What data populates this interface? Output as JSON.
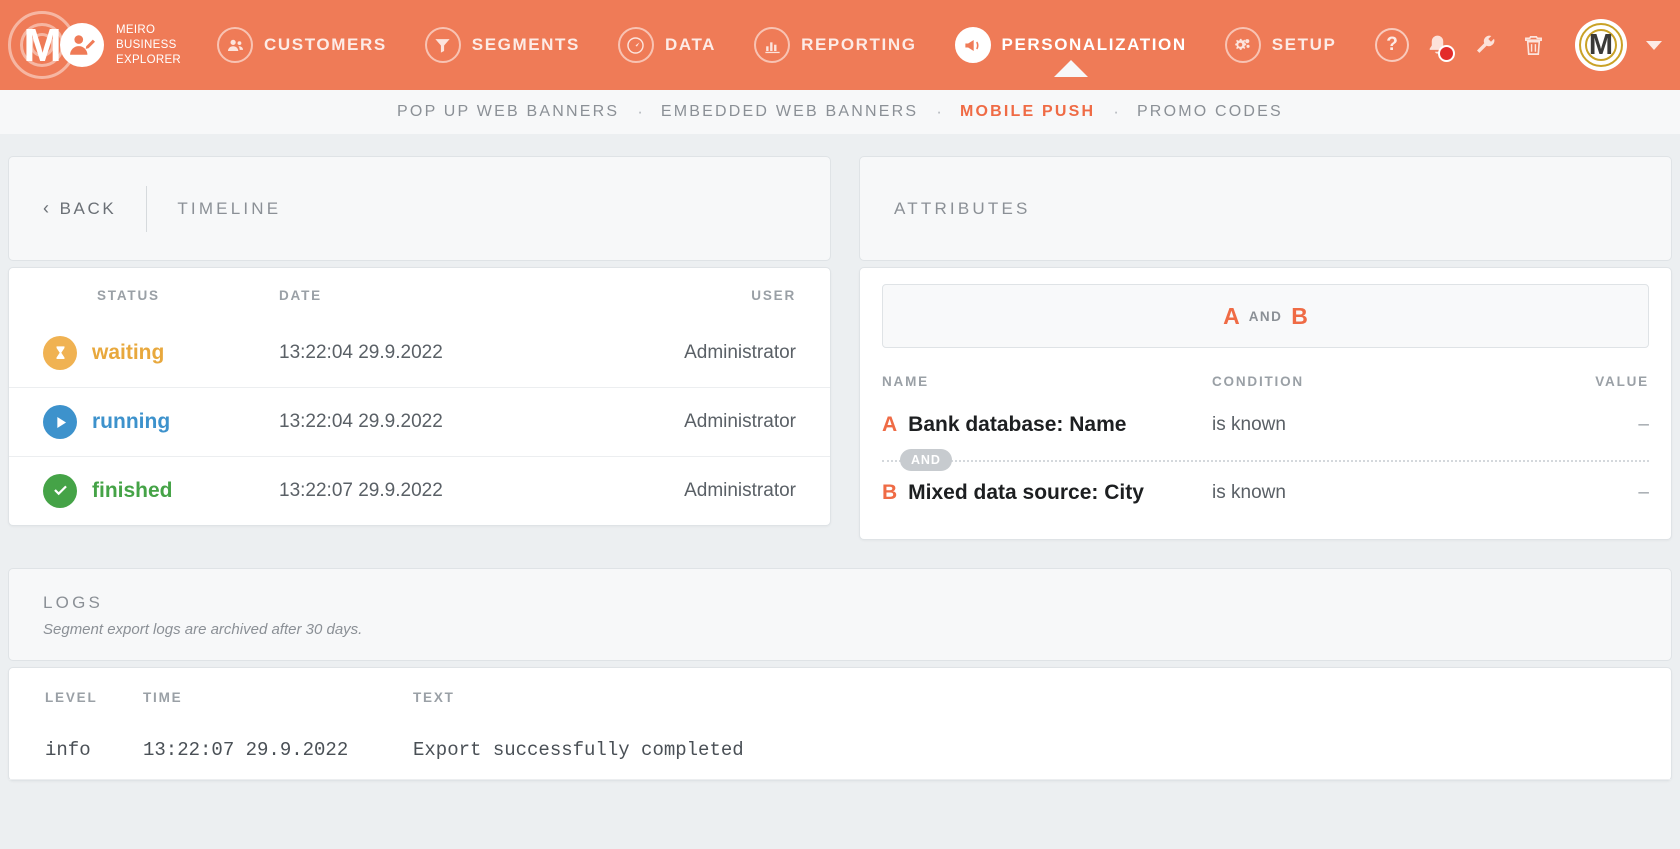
{
  "brand": {
    "letter": "M",
    "line1": "MEIRO",
    "line2": "BUSINESS",
    "line3": "EXPLORER"
  },
  "topnav": {
    "items": [
      {
        "label": "CUSTOMERS",
        "icon": "people-icon",
        "active": false
      },
      {
        "label": "SEGMENTS",
        "icon": "funnel-icon",
        "active": false
      },
      {
        "label": "DATA",
        "icon": "gauge-icon",
        "active": false
      },
      {
        "label": "REPORTING",
        "icon": "bar-chart-icon",
        "active": false
      },
      {
        "label": "PERSONALIZATION",
        "icon": "megaphone-icon",
        "active": true
      },
      {
        "label": "SETUP",
        "icon": "gears-icon",
        "active": false
      }
    ],
    "tools": [
      {
        "name": "help-icon",
        "glyph": "?"
      },
      {
        "name": "bell-icon",
        "glyph": ""
      },
      {
        "name": "wrench-icon",
        "glyph": ""
      },
      {
        "name": "trash-icon",
        "glyph": ""
      }
    ],
    "avatar_letter": "M",
    "accent": "#ef7b57"
  },
  "subnav": {
    "items": [
      {
        "label": "POP UP WEB BANNERS",
        "active": false
      },
      {
        "label": "EMBEDDED WEB BANNERS",
        "active": false
      },
      {
        "label": "MOBILE PUSH",
        "active": true
      },
      {
        "label": "PROMO CODES",
        "active": false
      }
    ],
    "separator": "·"
  },
  "timeline": {
    "back_label": "BACK",
    "back_chevron": "‹",
    "title": "TIMELINE",
    "columns": {
      "status": "STATUS",
      "date": "DATE",
      "user": "USER"
    },
    "rows": [
      {
        "status": "waiting",
        "icon": "hourglass-icon",
        "color": "#f0b252",
        "date": "13:22:04 29.9.2022",
        "user": "Administrator"
      },
      {
        "status": "running",
        "icon": "play-icon",
        "color": "#3d92cc",
        "date": "13:22:04 29.9.2022",
        "user": "Administrator"
      },
      {
        "status": "finished",
        "icon": "check-icon",
        "color": "#45a347",
        "date": "13:22:07 29.9.2022",
        "user": "Administrator"
      }
    ]
  },
  "attributes": {
    "title": "ATTRIBUTES",
    "expression": {
      "a": "A",
      "and": "AND",
      "b": "B"
    },
    "columns": {
      "name": "NAME",
      "condition": "CONDITION",
      "value": "VALUE"
    },
    "operator_chip": "AND",
    "rows": [
      {
        "letter": "A",
        "name": "Bank database: Name",
        "condition": "is known",
        "value": "–"
      },
      {
        "letter": "B",
        "name": "Mixed data source: City",
        "condition": "is known",
        "value": "–"
      }
    ]
  },
  "logs": {
    "title": "LOGS",
    "subtitle": "Segment export logs are archived after 30 days.",
    "columns": {
      "level": "LEVEL",
      "time": "TIME",
      "text": "TEXT"
    },
    "rows": [
      {
        "level": "info",
        "time": "13:22:07 29.9.2022",
        "text": "Export successfully completed"
      }
    ]
  }
}
